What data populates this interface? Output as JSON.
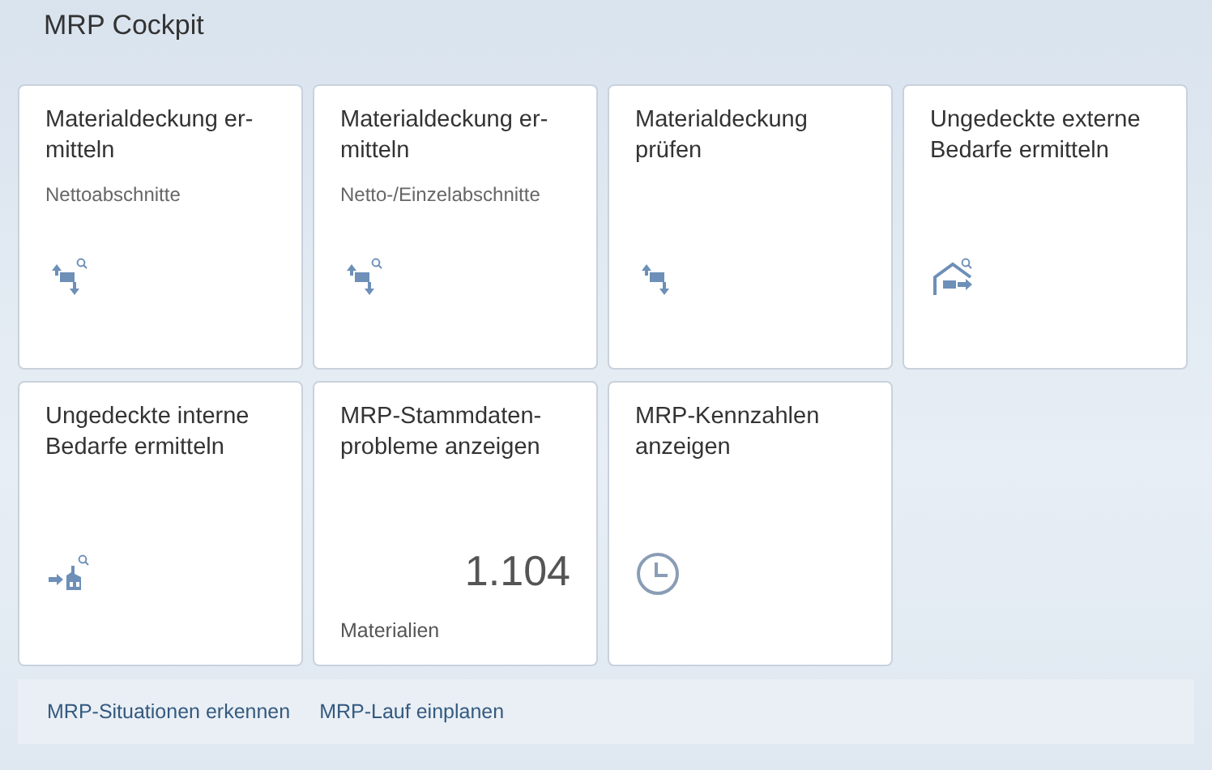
{
  "page": {
    "title": "MRP Cockpit"
  },
  "tiles": [
    {
      "title": "Materialdeckung er-\nmitteln",
      "subtitle": "Nettoabschnitte",
      "kind": "cover-search"
    },
    {
      "title": "Materialdeckung er-\nmitteln",
      "subtitle": "Netto-/Einzelabschnitte",
      "kind": "cover-search"
    },
    {
      "title": "Materialdeckung\nprüfen",
      "kind": "cover"
    },
    {
      "title": "Ungedeckte externe\nBedarfe ermitteln",
      "kind": "house"
    },
    {
      "title": "Ungedeckte interne\nBedarfe ermitteln",
      "kind": "factory"
    },
    {
      "title": "MRP-Stammdaten-\nprobleme anzeigen",
      "kind": "kpi",
      "value": "1.104",
      "unit": "Materialien"
    },
    {
      "title": "MRP-Kennzahlen\nanzeigen",
      "kind": "clock"
    }
  ],
  "footer_links": [
    "MRP-Situationen erkennen",
    "MRP-Lauf einplanen"
  ]
}
